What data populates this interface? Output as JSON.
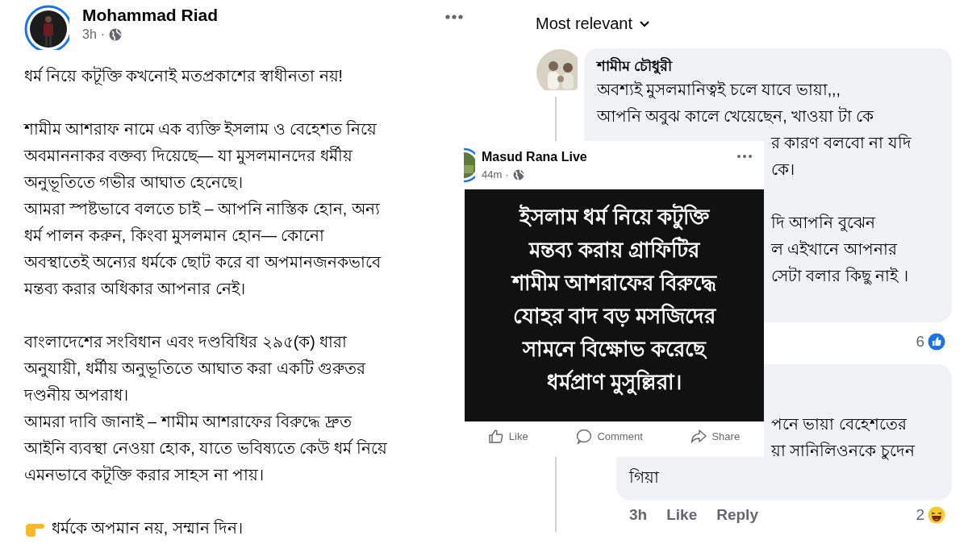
{
  "post": {
    "author": "Mohammad Riad",
    "time": "3h",
    "separator": "·",
    "paragraphs": [
      [
        "ধর্ম নিয়ে কটূক্তি কখনোই মতপ্রকাশের স্বাধীনতা নয়!"
      ],
      [
        "শামীম আশরাফ নামে এক ব্যক্তি ইসলাম ও বেহেশত নিয়ে",
        "অবমাননাকর বক্তব্য দিয়েছে— যা মুসলমানদের ধর্মীয়",
        "অনুভূতিতে গভীর আঘাত হেনেছে।",
        "আমরা স্পষ্টভাবে বলতে চাই – আপনি নাস্তিক হোন, অন্য",
        "ধর্ম পালন করুন, কিংবা মুসলমান হোন— কোনো",
        "অবস্থাতেই অন্যের ধর্মকে ছোট করে বা অপমানজনকভাবে",
        "মন্তব্য করার অধিকার আপনার নেই।"
      ],
      [
        "বাংলাদেশের সংবিধান এবং দণ্ডবিধির ২৯৫(ক) ধারা",
        "অনুযায়ী, ধর্মীয় অনুভূতিতে আঘাত করা একটি গুরুতর",
        "দণ্ডনীয় অপরাধ।",
        "আমরা দাবি জানাই – শামীম আশরাফের বিরুদ্ধে দ্রুত",
        "আইনি ব্যবস্থা নেওয়া হোক, যাতে ভবিষ্যতে কেউ ধর্ম নিয়ে",
        "এমনভাবে কটূক্তি করার সাহস না পায়।"
      ]
    ],
    "closing": "ধর্মকে অপমান নয়, সম্মান দিন।"
  },
  "comments_panel": {
    "sort": "Most relevant",
    "comments": [
      {
        "author": "শামীম চৌধুরী",
        "paragraphs": [
          [
            {
              "kind": "full",
              "lines": [
                "অবশ্যই মুসলমানিত্বই চলে যাবে ভায়া,,,",
                "আপনি অবুঝ কালে খেয়েছেন, খাওয়া টা কে"
              ]
            },
            {
              "kind": "cut",
              "lines": [
                "র কারণ বলবো না যদি",
                "কে।"
              ]
            }
          ],
          [
            {
              "kind": "cut",
              "lines": [
                "দি আপনি বুঝেন",
                "ল এইখানে আপনার",
                "সেটা বলার কিছু নাই ।"
              ]
            }
          ]
        ],
        "reaction": {
          "kind": "like",
          "count": "6"
        }
      },
      {
        "paragraphs": [
          [
            {
              "kind": "cut",
              "lines": [
                "পনে ভায়া বেহেশতের",
                "য়া সানিলিওনকে চুদেন"
              ]
            },
            {
              "kind": "full",
              "lines": [
                "গিয়া"
              ]
            }
          ]
        ],
        "time": "3h",
        "actions": [
          "Like",
          "Reply"
        ],
        "reaction": {
          "kind": "haha",
          "count": "2"
        }
      }
    ]
  },
  "shared_post": {
    "author": "Masud Rana Live",
    "time": "44m",
    "separator": "·",
    "graphic_lines": [
      "ইসলাম ধর্ম নিয়ে কটুক্তি",
      "মন্তব্য করায় গ্রাফিটির",
      "শামীম আশরাফের বিরুদ্ধে",
      "যোহর বাদ বড় মসজিদের",
      "সামনে বিক্ষোভ করেছে",
      "ধর্মপ্রাণ মুসুল্লিরা।"
    ],
    "actions": [
      {
        "kind": "like",
        "label": "Like"
      },
      {
        "kind": "comment",
        "label": "Comment"
      },
      {
        "kind": "share",
        "label": "Share"
      }
    ]
  }
}
